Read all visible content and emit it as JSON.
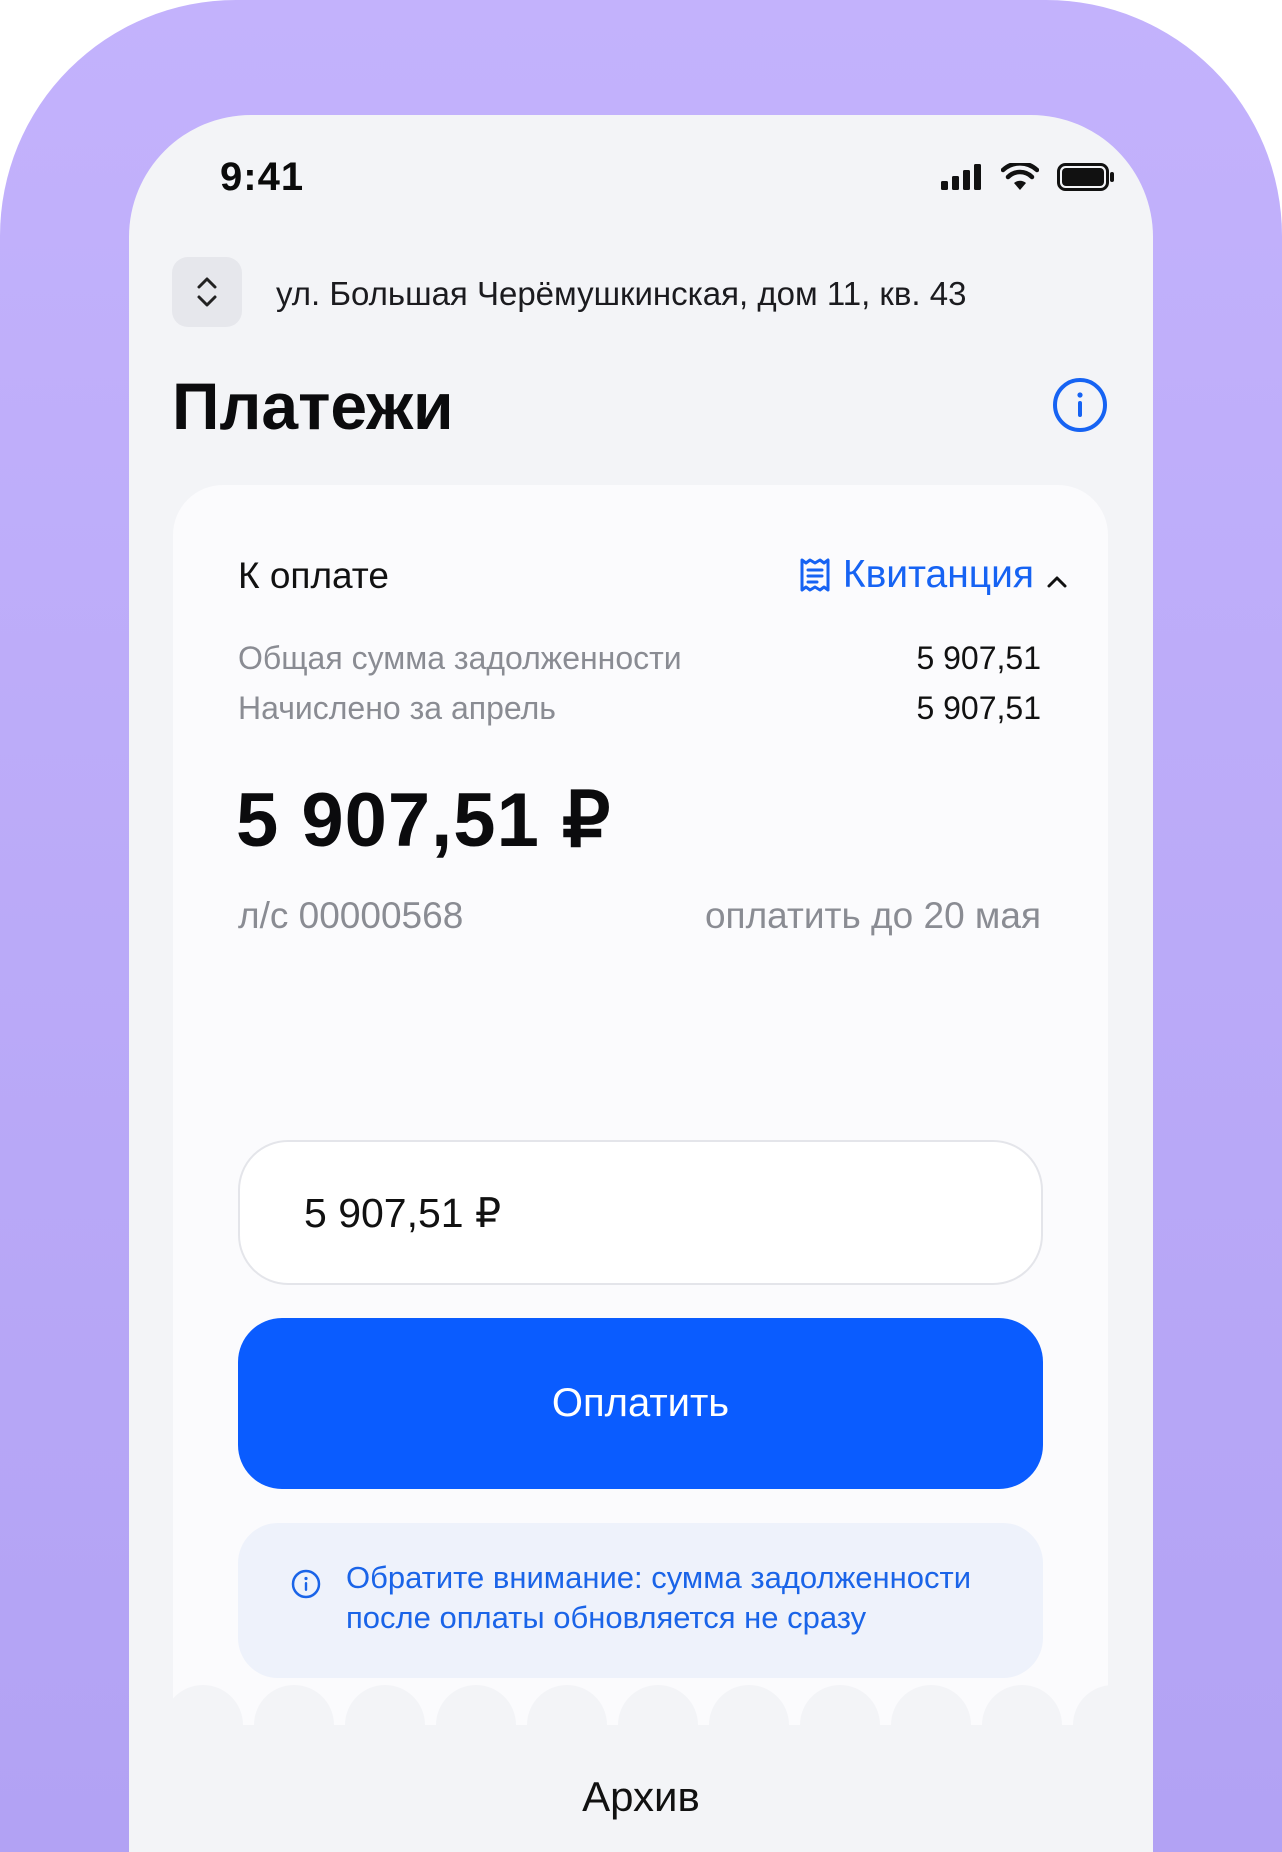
{
  "status_bar": {
    "time": "9:41"
  },
  "address": {
    "text": "ул. Большая Черёмушкинская, дом 11, кв. 43"
  },
  "page": {
    "title": "Платежи"
  },
  "payment_card": {
    "header_label": "К оплате",
    "receipt_link": "Квитанция",
    "rows": [
      {
        "label": "Общая сумма задолженности",
        "value": "5 907,51"
      },
      {
        "label": "Начислено за апрель",
        "value": "5 907,51"
      }
    ],
    "total": "5 907,51 ₽",
    "account": "л/с 00000568",
    "due_date": "оплатить до 20 мая",
    "amount_input_value": "5 907,51 ₽",
    "pay_button_label": "Оплатить",
    "notice": "Обратите внимание: сумма задолженности после оплаты обновляется не сразу"
  },
  "bottom": {
    "archive_label": "Архив"
  },
  "icons": {
    "address_toggle": "chevron-up-down-icon",
    "info": "info-icon",
    "receipt": "receipt-icon",
    "collapse": "chevron-up-icon"
  },
  "colors": {
    "accent": "#0a5cff",
    "link": "#1663f3",
    "frame": "#c3b2fc",
    "notice_bg": "#eef2fb"
  }
}
